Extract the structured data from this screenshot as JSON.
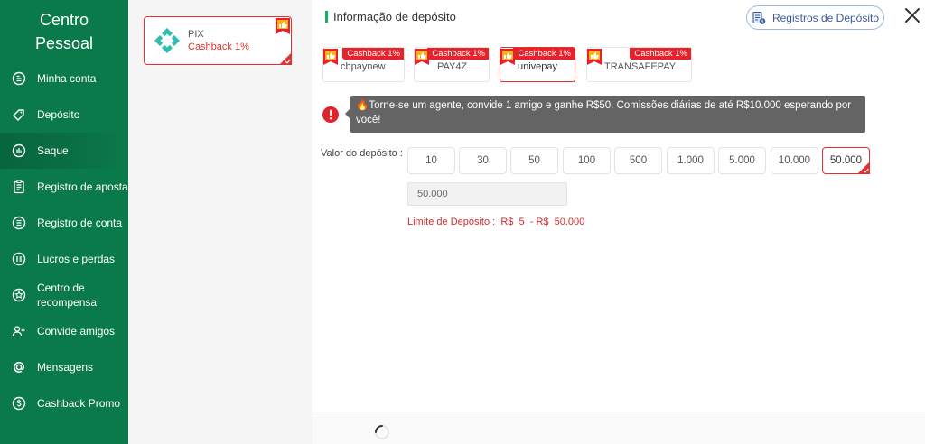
{
  "sidebar": {
    "title_line1": "Centro",
    "title_line2": "Pessoal",
    "items": [
      {
        "label": "Minha conta",
        "icon": "user-circle-icon"
      },
      {
        "label": "Depósito",
        "icon": "deposit-tag-icon"
      },
      {
        "label": "Saque",
        "icon": "withdraw-chart-icon",
        "active": true
      },
      {
        "label": "Registro de apostas",
        "icon": "bet-record-icon"
      },
      {
        "label": "Registro de conta",
        "icon": "account-record-icon"
      },
      {
        "label": "Lucros e perdas",
        "icon": "profit-loss-icon"
      },
      {
        "label": "Centro de recompensa",
        "icon": "reward-center-icon"
      },
      {
        "label": "Convide amigos",
        "icon": "invite-friends-icon"
      },
      {
        "label": "Mensagens",
        "icon": "at-sign-icon"
      },
      {
        "label": "Cashback Promo",
        "icon": "cashback-icon"
      }
    ]
  },
  "method": {
    "name": "PIX",
    "cashback": "Cashback 1%"
  },
  "header": {
    "title": "Informação de depósito",
    "records_button": "Registros de Depósito"
  },
  "providers": [
    {
      "name": "cbpaynew",
      "tag": "Cashback 1%"
    },
    {
      "name": "PAY4Z",
      "tag": "Cashback 1%"
    },
    {
      "name": "univepay",
      "tag": "Cashback 1%",
      "selected": true
    },
    {
      "name": "TRANSAFEPAY",
      "tag": "Cashback 1%"
    }
  ],
  "notice": {
    "emoji": "🔥",
    "text": "Torne-se um agente, convide 1 amigo e ganhe R$50. Comissões diárias de até R$10.000 esperando por você!"
  },
  "deposit": {
    "label": "Valor do depósito :",
    "amounts": [
      "10",
      "30",
      "50",
      "100",
      "500",
      "1.000",
      "5.000",
      "10.000",
      "50.000"
    ],
    "selected_amount": "50.000",
    "input_value": "50.000",
    "limit": "Limite de Depósito :  R$  5  - R$  50.000"
  },
  "colors": {
    "sidebar_bg": "#0b7a4b",
    "accent_red": "#e0322f",
    "tag_red": "#e8222b",
    "title_bar_green": "#14b25a"
  }
}
